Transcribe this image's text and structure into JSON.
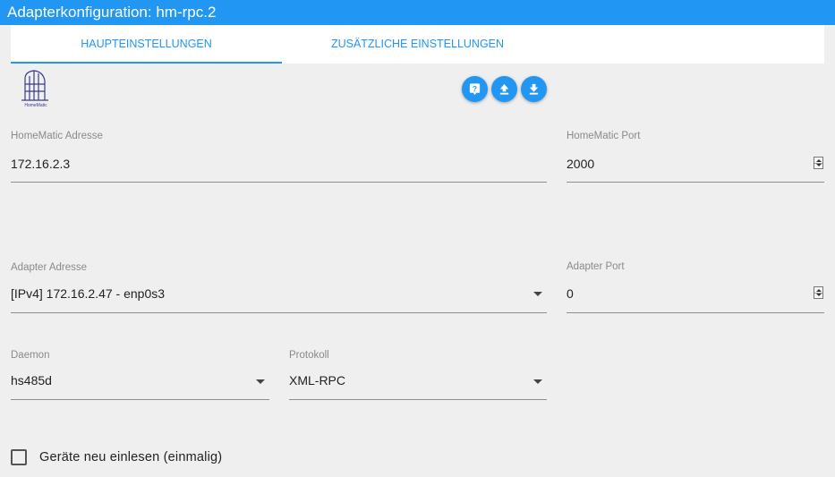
{
  "window": {
    "title": "Adapterkonfiguration: hm-rpc.2"
  },
  "tabs": [
    {
      "label": "HAUPTEINSTELLUNGEN",
      "active": true
    },
    {
      "label": "ZUSÄTZLICHE EINSTELLUNGEN",
      "active": false
    }
  ],
  "logo": {
    "text": "HomeMatic"
  },
  "toolbar": {
    "help_icon": "help-icon",
    "upload_icon": "upload-icon",
    "download_icon": "download-icon"
  },
  "fields": {
    "homematic_address": {
      "label": "HomeMatic Adresse",
      "value": "172.16.2.3"
    },
    "homematic_port": {
      "label": "HomeMatic Port",
      "value": "2000"
    },
    "adapter_address": {
      "label": "Adapter Adresse",
      "value": "[IPv4] 172.16.2.47 - enp0s3"
    },
    "adapter_port": {
      "label": "Adapter Port",
      "value": "0"
    },
    "daemon": {
      "label": "Daemon",
      "value": "hs485d"
    },
    "protocol": {
      "label": "Protokoll",
      "value": "XML-RPC"
    }
  },
  "options": {
    "reread_devices": {
      "label": "Geräte neu einlesen (einmalig)",
      "checked": false
    }
  },
  "colors": {
    "accent": "#2196f3",
    "background": "#efefef",
    "surface": "#ffffff"
  }
}
